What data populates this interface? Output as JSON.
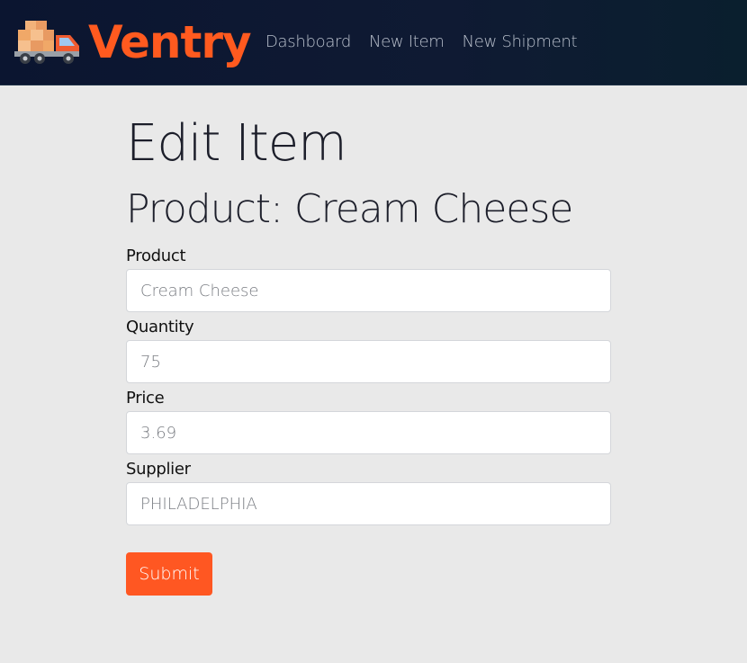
{
  "nav": {
    "brand": "Ventry",
    "links": [
      "Dashboard",
      "New Item",
      "New Shipment"
    ]
  },
  "page": {
    "title": "Edit Item",
    "heading": "Product: Cream Cheese"
  },
  "form": {
    "product_label": "Product",
    "product_value": "Cream Cheese",
    "quantity_label": "Quantity",
    "quantity_value": "75",
    "price_label": "Price",
    "price_value": "3.69",
    "supplier_label": "Supplier",
    "supplier_value": "PHILADELPHIA",
    "submit_label": "Submit"
  },
  "colors": {
    "brand": "#ff5a1f",
    "button": "#ff5722",
    "nav_bg": "#0f1a33",
    "page_bg": "#e9e9e9"
  },
  "icons": {
    "brand_logo": "delivery-truck-icon"
  }
}
